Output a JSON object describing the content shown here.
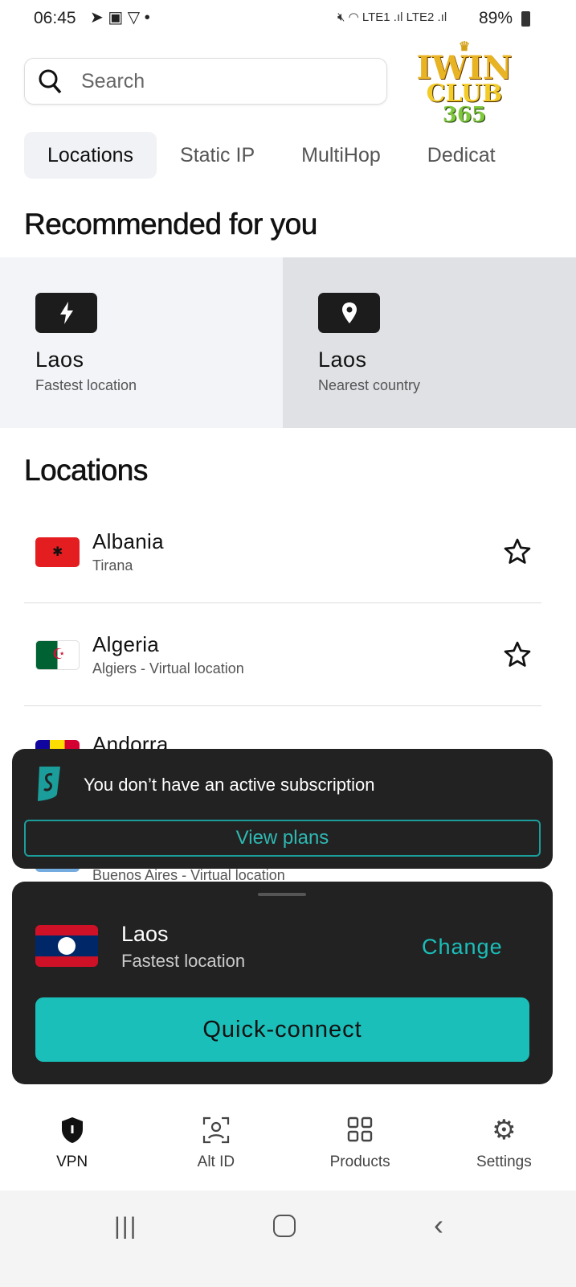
{
  "status_bar": {
    "time": "06:45",
    "battery": "89%",
    "sim1": "LTE1",
    "sim2": "LTE2"
  },
  "logo": {
    "line1": "IWIN",
    "line2": "CLUB",
    "line3": "365"
  },
  "search": {
    "placeholder": "Search"
  },
  "tabs": [
    {
      "label": "Locations",
      "active": true
    },
    {
      "label": "Static IP"
    },
    {
      "label": "MultiHop"
    },
    {
      "label": "Dedicat"
    }
  ],
  "recommended": {
    "title": "Recommended for you",
    "cards": [
      {
        "name": "Laos",
        "sub": "Fastest location",
        "icon": "lightning-icon"
      },
      {
        "name": "Laos",
        "sub": "Nearest country",
        "icon": "location-pin-icon"
      }
    ]
  },
  "locations": {
    "title": "Locations",
    "items": [
      {
        "name": "Albania",
        "sub": "Tirana"
      },
      {
        "name": "Algeria",
        "sub": "Algiers - Virtual location"
      },
      {
        "name": "Andorra",
        "sub": ""
      },
      {
        "name": "",
        "sub": "Buenos Aires - Virtual location"
      }
    ]
  },
  "toast": {
    "message": "You don’t have an active subscription",
    "button": "View plans"
  },
  "sheet": {
    "name": "Laos",
    "sub": "Fastest location",
    "change": "Change",
    "connect": "Quick-connect"
  },
  "nav": [
    {
      "label": "VPN"
    },
    {
      "label": "Alt ID"
    },
    {
      "label": "Products"
    },
    {
      "label": "Settings"
    }
  ],
  "colors": {
    "accent": "#1bbfb9",
    "dark": "#222222"
  }
}
